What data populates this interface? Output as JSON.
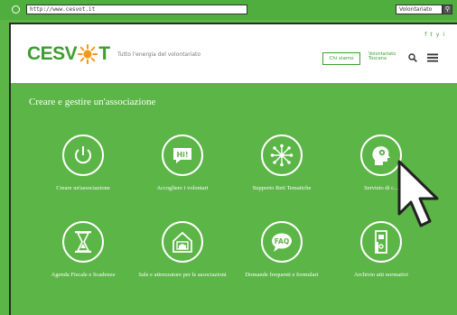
{
  "browser": {
    "url": "http://www.cesvot.it",
    "search_value": "Volontariato",
    "search_button_icon": "search-icon"
  },
  "header": {
    "logo_text_left": "CESV",
    "logo_text_right": "T",
    "tagline": "Tutto l'energia del volontariato",
    "chi_siamo_label": "Chi siamo",
    "partner_label": "Volontariato Toscana",
    "social_icons": [
      "f",
      "t",
      "y",
      "i"
    ]
  },
  "main": {
    "section_title": "Creare e gestire un'associazione",
    "tiles": [
      {
        "icon": "power-icon",
        "label": "Creare un'associazione"
      },
      {
        "icon": "hi-speech-bubble-icon",
        "label": "Accogliere i volontari"
      },
      {
        "icon": "network-icon",
        "label": "Supporto Reti Tematiche"
      },
      {
        "icon": "head-gear-icon",
        "label": "Servizio di c..."
      },
      {
        "icon": "hourglass-icon",
        "label": "Agenda Fiscale e Scadenze"
      },
      {
        "icon": "house-icon",
        "label": "Sale e attrezzature per le associazioni"
      },
      {
        "icon": "faq-bubble-icon",
        "label": "Domande frequenti e formulari"
      },
      {
        "icon": "binder-icon",
        "label": "Archivio atti normativi"
      }
    ]
  },
  "colors": {
    "brand_green": "#5cb547",
    "logo_green": "#3d9e31",
    "sun_orange": "#f39a1e"
  }
}
